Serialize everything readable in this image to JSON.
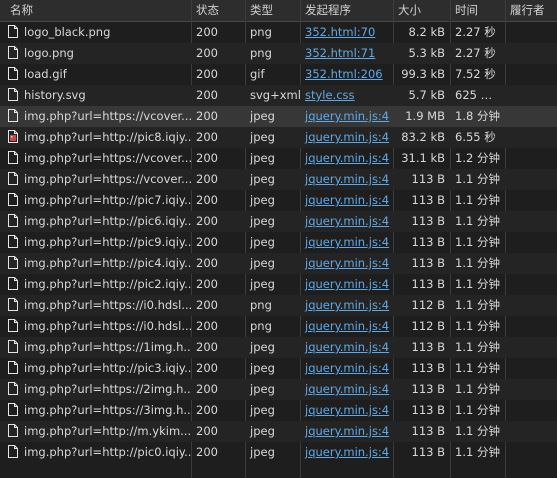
{
  "columns": {
    "name": "名称",
    "status": "状态",
    "type": "类型",
    "initiator": "发起程序",
    "size": "大小",
    "time": "时间",
    "waterfall": "履行者"
  },
  "rows": [
    {
      "name": "logo_black.png",
      "status": "200",
      "type": "png",
      "initiator": "352.html:70",
      "size": "8.2 kB",
      "time": "2.27 秒",
      "icon": "document-icon"
    },
    {
      "name": "logo.png",
      "status": "200",
      "type": "png",
      "initiator": "352.html:71",
      "size": "5.3 kB",
      "time": "2.27 秒",
      "icon": "document-icon"
    },
    {
      "name": "load.gif",
      "status": "200",
      "type": "gif",
      "initiator": "352.html:206",
      "size": "99.3 kB",
      "time": "7.52 秒",
      "icon": "document-icon"
    },
    {
      "name": "history.svg",
      "status": "200",
      "type": "svg+xml",
      "initiator": "style.css",
      "size": "5.7 kB",
      "time": "625 …",
      "icon": "document-icon"
    },
    {
      "name": "img.php?url=https://vcover...",
      "status": "200",
      "type": "jpeg",
      "initiator": "jquery.min.js:4",
      "size": "1.9 MB",
      "time": "1.8 分钟",
      "icon": "document-icon",
      "selected": true
    },
    {
      "name": "img.php?url=http://pic8.iqiy...",
      "status": "200",
      "type": "jpeg",
      "initiator": "jquery.min.js:4",
      "size": "83.2 kB",
      "time": "6.55 秒",
      "icon": "image-document-icon"
    },
    {
      "name": "img.php?url=https://vcover...",
      "status": "200",
      "type": "jpeg",
      "initiator": "jquery.min.js:4",
      "size": "31.1 kB",
      "time": "1.2 分钟",
      "icon": "document-icon"
    },
    {
      "name": "img.php?url=https://vcover...",
      "status": "200",
      "type": "jpeg",
      "initiator": "jquery.min.js:4",
      "size": "113 B",
      "time": "1.1 分钟",
      "icon": "document-icon"
    },
    {
      "name": "img.php?url=http://pic7.iqiy...",
      "status": "200",
      "type": "jpeg",
      "initiator": "jquery.min.js:4",
      "size": "113 B",
      "time": "1.1 分钟",
      "icon": "document-icon"
    },
    {
      "name": "img.php?url=http://pic6.iqiy...",
      "status": "200",
      "type": "jpeg",
      "initiator": "jquery.min.js:4",
      "size": "113 B",
      "time": "1.1 分钟",
      "icon": "document-icon"
    },
    {
      "name": "img.php?url=http://pic9.iqiy...",
      "status": "200",
      "type": "jpeg",
      "initiator": "jquery.min.js:4",
      "size": "113 B",
      "time": "1.1 分钟",
      "icon": "document-icon"
    },
    {
      "name": "img.php?url=http://pic4.iqiy...",
      "status": "200",
      "type": "jpeg",
      "initiator": "jquery.min.js:4",
      "size": "113 B",
      "time": "1.1 分钟",
      "icon": "document-icon"
    },
    {
      "name": "img.php?url=http://pic2.iqiy...",
      "status": "200",
      "type": "jpeg",
      "initiator": "jquery.min.js:4",
      "size": "113 B",
      "time": "1.1 分钟",
      "icon": "document-icon"
    },
    {
      "name": "img.php?url=https://i0.hdsl...",
      "status": "200",
      "type": "png",
      "initiator": "jquery.min.js:4",
      "size": "112 B",
      "time": "1.1 分钟",
      "icon": "document-icon"
    },
    {
      "name": "img.php?url=https://i0.hdsl...",
      "status": "200",
      "type": "png",
      "initiator": "jquery.min.js:4",
      "size": "112 B",
      "time": "1.1 分钟",
      "icon": "document-icon"
    },
    {
      "name": "img.php?url=https://1img.h...",
      "status": "200",
      "type": "jpeg",
      "initiator": "jquery.min.js:4",
      "size": "113 B",
      "time": "1.1 分钟",
      "icon": "document-icon"
    },
    {
      "name": "img.php?url=http://pic3.iqiy...",
      "status": "200",
      "type": "jpeg",
      "initiator": "jquery.min.js:4",
      "size": "113 B",
      "time": "1.1 分钟",
      "icon": "document-icon"
    },
    {
      "name": "img.php?url=https://2img.h...",
      "status": "200",
      "type": "jpeg",
      "initiator": "jquery.min.js:4",
      "size": "113 B",
      "time": "1.1 分钟",
      "icon": "document-icon"
    },
    {
      "name": "img.php?url=https://3img.h...",
      "status": "200",
      "type": "jpeg",
      "initiator": "jquery.min.js:4",
      "size": "113 B",
      "time": "1.1 分钟",
      "icon": "document-icon"
    },
    {
      "name": "img.php?url=http://m.ykim...",
      "status": "200",
      "type": "jpeg",
      "initiator": "jquery.min.js:4",
      "size": "113 B",
      "time": "1.1 分钟",
      "icon": "document-icon"
    },
    {
      "name": "img.php?url=http://pic0.iqiy...",
      "status": "200",
      "type": "jpeg",
      "initiator": "jquery.min.js:4",
      "size": "113 B",
      "time": "1.1 分钟",
      "icon": "document-icon"
    }
  ],
  "colors": {
    "background": "#1e1e1e",
    "header": "#2d2d2d",
    "link": "#5fa9e6",
    "text": "#d8d8d8",
    "selected_row": "#373737"
  }
}
